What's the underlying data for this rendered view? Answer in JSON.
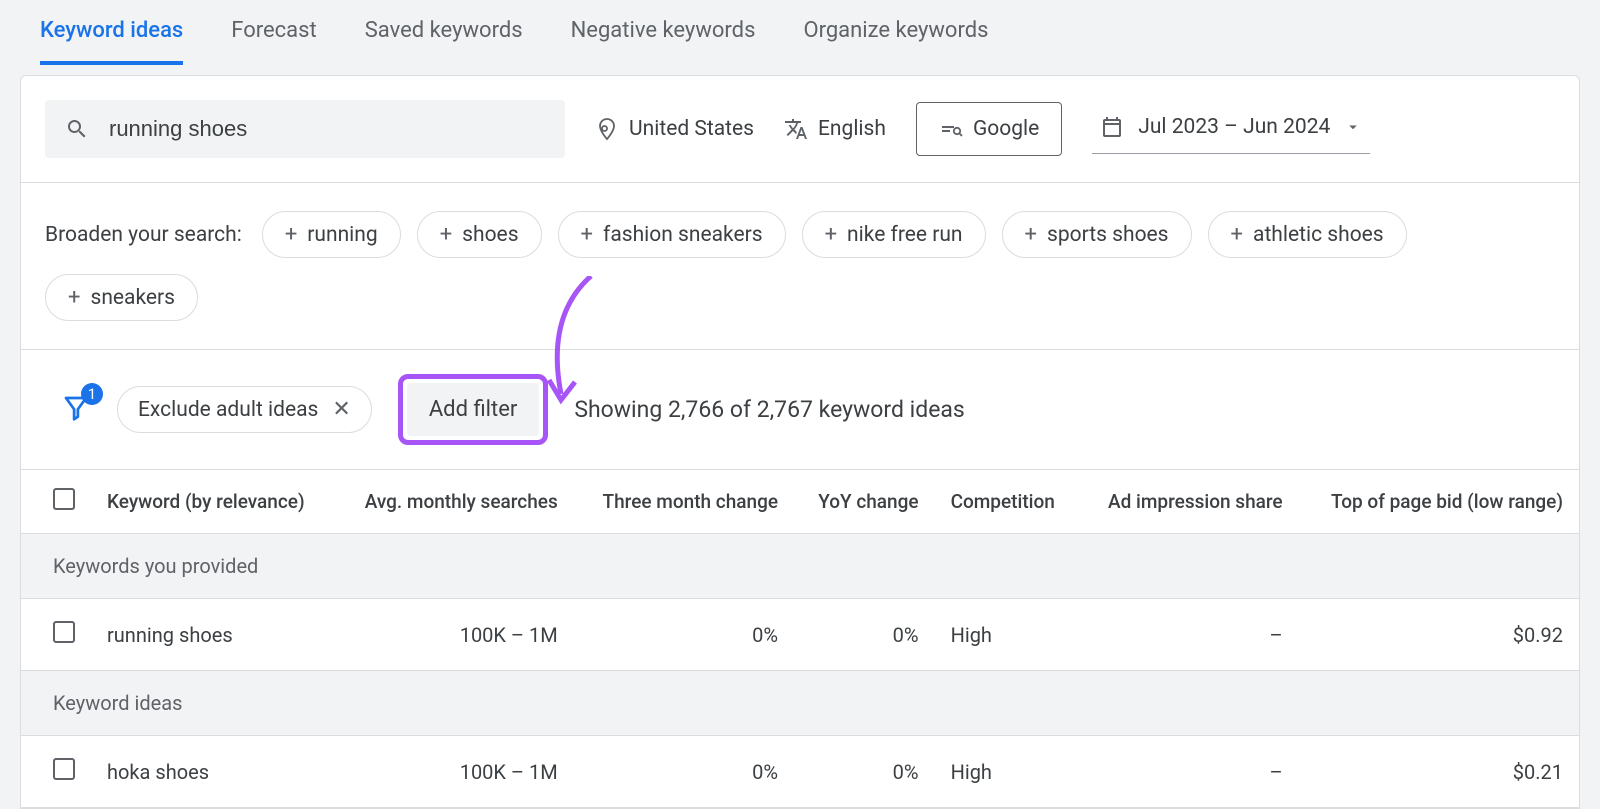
{
  "tabs": [
    "Keyword ideas",
    "Forecast",
    "Saved keywords",
    "Negative keywords",
    "Organize keywords"
  ],
  "search": {
    "value": "running shoes"
  },
  "controls": {
    "location": "United States",
    "language": "English",
    "network": "Google",
    "daterange": "Jul 2023 – Jun 2024"
  },
  "broaden": {
    "label": "Broaden your search:",
    "chips": [
      "running",
      "shoes",
      "fashion sneakers",
      "nike free run",
      "sports shoes",
      "athletic shoes",
      "sneakers"
    ]
  },
  "filters": {
    "badge": "1",
    "active_chip": "Exclude adult ideas",
    "add_label": "Add filter",
    "showing": "Showing 2,766 of 2,767 keyword ideas"
  },
  "table": {
    "headers": [
      "",
      "Keyword (by relevance)",
      "Avg. monthly searches",
      "Three month change",
      "YoY change",
      "Competition",
      "Ad impression share",
      "Top of page bid (low range)"
    ],
    "sections": [
      {
        "title": "Keywords you provided",
        "rows": [
          {
            "keyword": "running shoes",
            "avg": "100K – 1M",
            "three": "0%",
            "yoy": "0%",
            "comp": "High",
            "ad": "–",
            "bid": "$0.92"
          }
        ]
      },
      {
        "title": "Keyword ideas",
        "rows": [
          {
            "keyword": "hoka shoes",
            "avg": "100K – 1M",
            "three": "0%",
            "yoy": "0%",
            "comp": "High",
            "ad": "–",
            "bid": "$0.21"
          }
        ]
      }
    ]
  }
}
